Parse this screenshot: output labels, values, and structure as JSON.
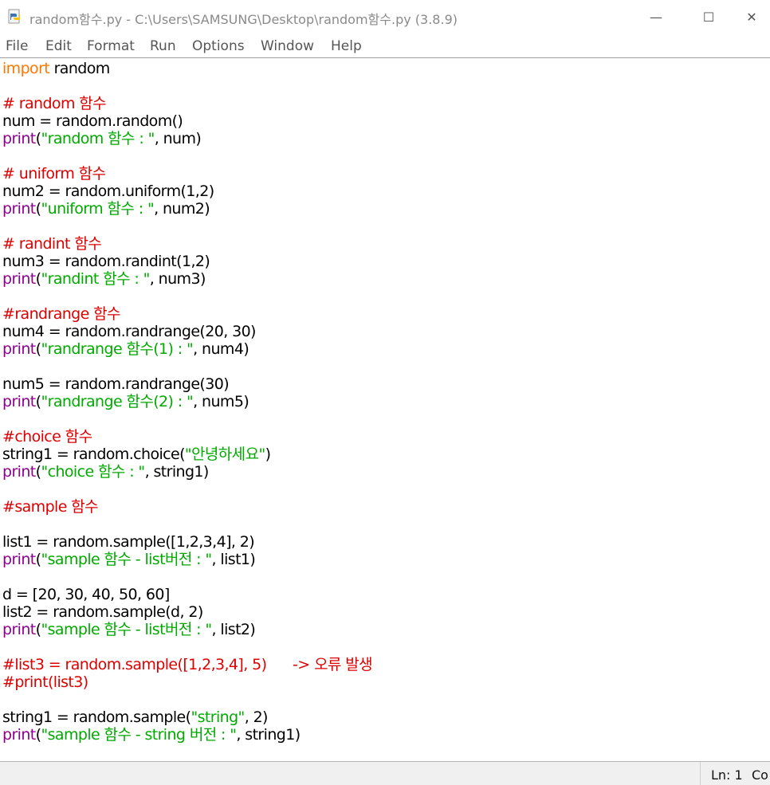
{
  "window": {
    "title": "random함수.py - C:\\Users\\SAMSUNG\\Desktop\\random함수.py (3.8.9)",
    "minimize": "—",
    "maximize": "☐",
    "close": "✕"
  },
  "menu": [
    "File",
    "Edit",
    "Format",
    "Run",
    "Options",
    "Window",
    "Help"
  ],
  "code": {
    "l1": {
      "a": "import",
      "b": " random"
    },
    "l3": "# random 함수",
    "l4": "num = random.random()",
    "l5": {
      "a": "print",
      "b": "(",
      "c": "\"random 함수 : \"",
      "d": ", num)"
    },
    "l7": "# uniform 함수",
    "l8": "num2 = random.uniform(1,2)",
    "l9": {
      "a": "print",
      "b": "(",
      "c": "\"uniform 함수 : \"",
      "d": ", num2)"
    },
    "l11": "# randint 함수",
    "l12": "num3 = random.randint(1,2)",
    "l13": {
      "a": "print",
      "b": "(",
      "c": "\"randint 함수 : \"",
      "d": ", num3)"
    },
    "l15": "#randrange 함수",
    "l16": "num4 = random.randrange(20, 30)",
    "l17": {
      "a": "print",
      "b": "(",
      "c": "\"randrange 함수(1) : \"",
      "d": ", num4)"
    },
    "l19": "num5 = random.randrange(30)",
    "l20": {
      "a": "print",
      "b": "(",
      "c": "\"randrange 함수(2) : \"",
      "d": ", num5)"
    },
    "l22": "#choice 함수",
    "l23": {
      "a": "string1 = random.choice(",
      "b": "\"안녕하세요\"",
      "c": ")"
    },
    "l24": {
      "a": "print",
      "b": "(",
      "c": "\"choice 함수 : \"",
      "d": ", string1)"
    },
    "l26": "#sample 함수",
    "l28": "list1 = random.sample([1,2,3,4], 2)",
    "l29": {
      "a": "print",
      "b": "(",
      "c": "\"sample 함수 - list버전 : \"",
      "d": ", list1)"
    },
    "l31": "d = [20, 30, 40, 50, 60]",
    "l32": "list2 = random.sample(d, 2)",
    "l33": {
      "a": "print",
      "b": "(",
      "c": "\"sample 함수 - list버전 : \"",
      "d": ", list2)"
    },
    "l35": "#list3 = random.sample([1,2,3,4], 5)      -> 오류 발생",
    "l36": "#print(list3)",
    "l38": {
      "a": "string1 = random.sample(",
      "b": "\"string\"",
      "c": ", 2)"
    },
    "l39": {
      "a": "print",
      "b": "(",
      "c": "\"sample 함수 - string 버전 : \"",
      "d": ", string1)"
    }
  },
  "status": {
    "ln": "Ln: 1",
    "col": "Co"
  }
}
